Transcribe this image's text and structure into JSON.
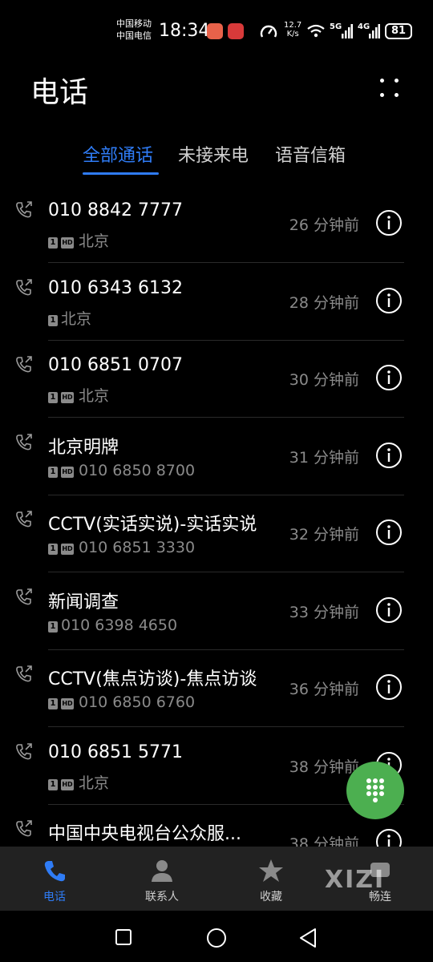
{
  "status_bar": {
    "carrier_1": "中国移动",
    "carrier_2": "中国电信",
    "time": "18:34",
    "net_speed_value": "12.7",
    "net_speed_unit": "K/s",
    "sig1_label": "5G",
    "sig2_label": "4G",
    "battery": "81"
  },
  "header": {
    "title": "电话"
  },
  "tabs": [
    {
      "label": "全部通话",
      "active": true
    },
    {
      "label": "未接来电",
      "active": false
    },
    {
      "label": "语音信箱",
      "active": false
    }
  ],
  "calls": [
    {
      "name": "010 8842 7777",
      "sim": "1",
      "hd": "HD",
      "detail": "北京",
      "time": "26 分钟前"
    },
    {
      "name": "010 6343 6132",
      "sim": "1",
      "hd": "",
      "detail": "北京",
      "time": "28 分钟前"
    },
    {
      "name": "010 6851 0707",
      "sim": "1",
      "hd": "HD",
      "detail": "北京",
      "time": "30 分钟前"
    },
    {
      "name": "北京明牌",
      "sim": "1",
      "hd": "HD",
      "detail": "010 6850 8700",
      "time": "31 分钟前"
    },
    {
      "name": "CCTV(实话实说)-实话实说",
      "sim": "1",
      "hd": "HD",
      "detail": "010 6851 3330",
      "time": "32 分钟前"
    },
    {
      "name": "新闻调查",
      "sim": "1",
      "hd": "",
      "detail": "010 6398 4650",
      "time": "33 分钟前"
    },
    {
      "name": "CCTV(焦点访谈)-焦点访谈",
      "sim": "1",
      "hd": "HD",
      "detail": "010 6850 6760",
      "time": "36 分钟前"
    },
    {
      "name": "010 6851 5771",
      "sim": "1",
      "hd": "HD",
      "detail": "北京",
      "time": "38 分钟前"
    },
    {
      "name": "中国中央电视台公众服...",
      "sim": "",
      "hd": "",
      "detail": "",
      "time": "38 分钟前"
    }
  ],
  "bottom_nav": [
    {
      "label": "电话",
      "icon": "phone-icon",
      "active": true
    },
    {
      "label": "联系人",
      "icon": "contacts-icon",
      "active": false
    },
    {
      "label": "收藏",
      "icon": "star-icon",
      "active": false
    },
    {
      "label": "畅连",
      "icon": "changlian-icon",
      "active": false
    }
  ],
  "watermark": "XIZI",
  "colors": {
    "accent": "#2f7cf6",
    "fab": "#4caf50",
    "secondary_text": "#8a8a8a"
  }
}
